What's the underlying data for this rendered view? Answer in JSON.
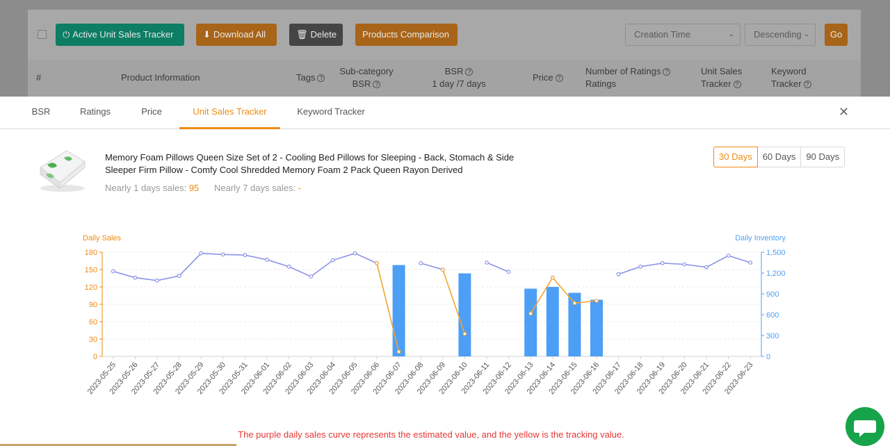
{
  "toolbar": {
    "active_label": "Active Unit Sales Tracker",
    "download_label": "Download All",
    "delete_label": "Delete",
    "compare_label": "Products Comparison",
    "sort_field": "Creation Time",
    "sort_order": "Descending",
    "go_label": "Go"
  },
  "table_headers": {
    "index": "#",
    "product": "Product Information",
    "tags": "Tags",
    "subcat_1": "Sub-category",
    "subcat_2": "BSR",
    "bsr_1": "BSR",
    "bsr_2": "1 day /7 days",
    "price": "Price",
    "ratings_1": "Number of Ratings",
    "ratings_2": "Ratings",
    "unit_1": "Unit Sales",
    "unit_2": "Tracker",
    "keyword_1": "Keyword",
    "keyword_2": "Tracker"
  },
  "tabs": [
    "BSR",
    "Ratings",
    "Price",
    "Unit Sales Tracker",
    "Keyword Tracker"
  ],
  "active_tab": "Unit Sales Tracker",
  "product": {
    "title": "Memory Foam Pillows Queen Size Set of 2 - Cooling Bed Pillows for Sleeping - Back, Stomach & Side Sleeper Firm Pillow - Comfy Cool Shredded Memory Foam 2 Pack Queen Rayon Derived",
    "sales_1d_label": "Nearly 1 days sales:",
    "sales_1d_value": "95",
    "sales_7d_label": "Nearly 7 days sales:",
    "sales_7d_value": "-"
  },
  "range_options": [
    "30 Days",
    "60 Days",
    "90 Days"
  ],
  "selected_range": "30 Days",
  "note": "The purple daily sales curve represents the estimated value, and the yellow is the tracking value.",
  "colors": {
    "accent": "#ee8a14",
    "estimated_line": "#8b93e6",
    "tracking_line": "#f2a531",
    "inventory_bar": "#4d9ef5",
    "chat": "#17a34a",
    "note": "#e53935"
  },
  "chart_data": {
    "type": "bar",
    "x": [
      "2023-05-25",
      "2023-05-26",
      "2023-05-27",
      "2023-05-28",
      "2023-05-29",
      "2023-05-30",
      "2023-05-31",
      "2023-06-01",
      "2023-06-02",
      "2023-06-03",
      "2023-06-04",
      "2023-06-05",
      "2023-06-06",
      "2023-06-07",
      "2023-06-08",
      "2023-06-09",
      "2023-06-10",
      "2023-06-11",
      "2023-06-12",
      "2023-06-13",
      "2023-06-14",
      "2023-06-15",
      "2023-06-16",
      "2023-06-17",
      "2023-06-18",
      "2023-06-19",
      "2023-06-20",
      "2023-06-21",
      "2023-06-22",
      "2023-06-23"
    ],
    "ylabel_left": "Daily Sales",
    "ylabel_right": "Daily Inventory",
    "ylim_left": [
      0,
      180
    ],
    "yticks_left": [
      0,
      30,
      60,
      90,
      120,
      150,
      180
    ],
    "ylim_right": [
      0,
      1500
    ],
    "yticks_right": [
      "0",
      "300",
      "600",
      "900",
      "1,200",
      "1,500"
    ],
    "grid": true,
    "series": [
      {
        "type": "line",
        "axis": "left",
        "values": [
          147,
          136,
          131,
          139,
          178,
          176,
          175,
          167,
          155,
          138,
          166,
          178,
          161,
          null,
          161,
          150,
          null,
          162,
          146,
          null,
          136,
          null,
          null,
          142,
          155,
          161,
          159,
          154,
          174,
          162
        ]
      },
      {
        "type": "line",
        "axis": "left",
        "values": [
          null,
          null,
          null,
          null,
          null,
          null,
          null,
          null,
          null,
          null,
          null,
          null,
          161,
          8,
          null,
          150,
          39,
          null,
          null,
          74,
          136,
          92,
          96,
          null,
          null,
          null,
          null,
          null,
          null,
          null
        ]
      },
      {
        "type": "bar",
        "axis": "right",
        "values": [
          0,
          0,
          0,
          0,
          0,
          0,
          0,
          0,
          0,
          0,
          0,
          0,
          0,
          1315,
          0,
          0,
          1195,
          0,
          0,
          975,
          1000,
          915,
          815,
          0,
          0,
          0,
          0,
          0,
          0,
          0
        ]
      }
    ]
  }
}
